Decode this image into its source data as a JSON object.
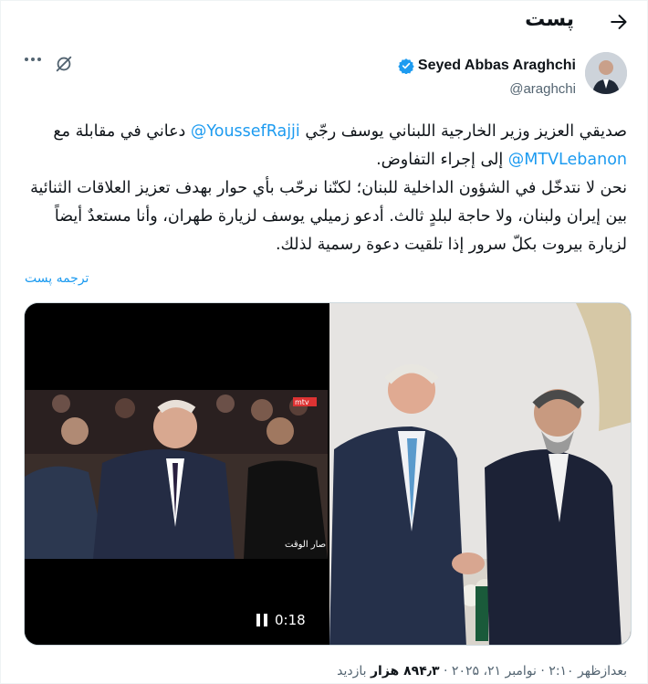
{
  "header": {
    "title": "پست"
  },
  "author": {
    "name": "Seyed Abbas Araghchi",
    "handle": "@araghchi"
  },
  "tweet": {
    "line1": "صديقي العزيز وزير الخارجية اللبناني يوسف رجّي",
    "mention1": "@YoussefRajji",
    "line1b": " دعاني في مقابلة مع",
    "mention2": "@MTVLebanon",
    "line2": " إلى إجراء التفاوض.",
    "para2": "نحن لا نتدخّل في الشؤون الداخلية للبنان؛ لكنّنا نرحّب بأي حوار بهدف تعزيز العلاقات الثنائية بين إيران ولبنان، ولا حاجة لبلدٍ ثالث. أدعو زميلي يوسف لزيارة طهران، وأنا مستعدٌ أيضاً لزيارة بيروت بكلّ سرور إذا تلقيت دعوة رسمية لذلك."
  },
  "translate_label": "ترجمه پست",
  "video": {
    "duration": "0:18",
    "channel_logo": "mtv",
    "show_caption": "صار الوقت"
  },
  "footer": {
    "time": "بعدازظهر ۲:۱۰ · نوامبر ۲۱، ۲۰۲۵ · ",
    "views_count": "۸۹۴٫۳ هزار",
    "views_label": " بازدید"
  },
  "colors": {
    "accent": "#1d9bf0",
    "text": "#0f1419",
    "muted": "#536471"
  }
}
